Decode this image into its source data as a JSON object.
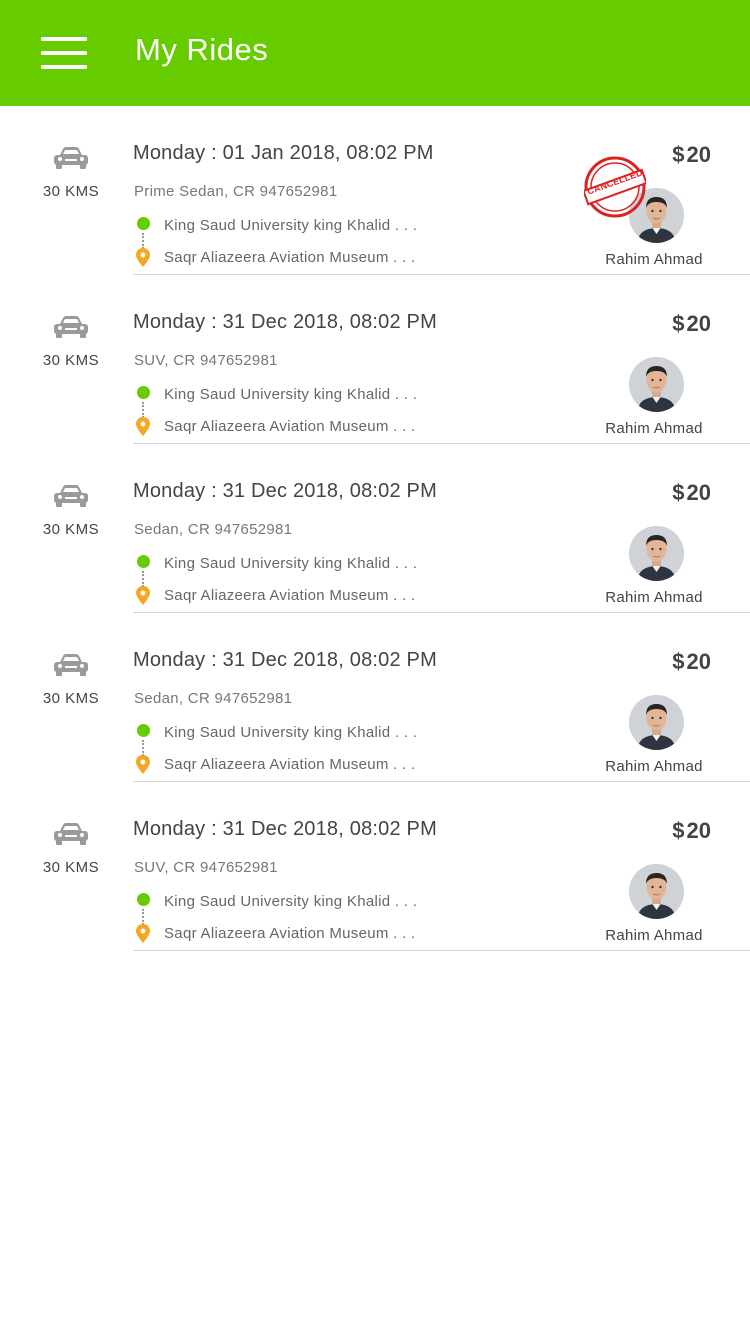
{
  "header": {
    "title": "My Rides"
  },
  "colors": {
    "brand": "#66cc00",
    "pickup": "#66cc00",
    "drop": "#f5a623",
    "stamp": "#e02020"
  },
  "rides": [
    {
      "distance": "30 KMS",
      "date": "Monday : 01 Jan 2018, 08:02 PM",
      "vehicle": "Prime Sedan, CR 947652981",
      "pickup": "King Saud University king Khalid . . .",
      "drop": "Saqr Aliazeera Aviation Museum . . .",
      "currency": "$",
      "fare": "20",
      "driver": "Rahim Ahmad",
      "status": "CANCELLED"
    },
    {
      "distance": "30 KMS",
      "date": "Monday : 31 Dec 2018, 08:02 PM",
      "vehicle": "SUV, CR 947652981",
      "pickup": "King Saud University king Khalid . . .",
      "drop": "Saqr Aliazeera Aviation Museum . . .",
      "currency": "$",
      "fare": "20",
      "driver": "Rahim Ahmad"
    },
    {
      "distance": "30 KMS",
      "date": "Monday : 31 Dec 2018, 08:02 PM",
      "vehicle": "Sedan, CR 947652981",
      "pickup": "King Saud University king Khalid . . .",
      "drop": "Saqr Aliazeera Aviation Museum . . .",
      "currency": "$",
      "fare": "20",
      "driver": "Rahim Ahmad"
    },
    {
      "distance": "30 KMS",
      "date": "Monday : 31 Dec 2018, 08:02 PM",
      "vehicle": "Sedan, CR 947652981",
      "pickup": "King Saud University king Khalid . . .",
      "drop": "Saqr Aliazeera Aviation Museum . . .",
      "currency": "$",
      "fare": "20",
      "driver": "Rahim Ahmad"
    },
    {
      "distance": "30 KMS",
      "date": "Monday : 31 Dec 2018, 08:02 PM",
      "vehicle": "SUV, CR 947652981",
      "pickup": "King Saud University king Khalid . . .",
      "drop": "Saqr Aliazeera Aviation Museum . . .",
      "currency": "$",
      "fare": "20",
      "driver": "Rahim Ahmad"
    }
  ]
}
